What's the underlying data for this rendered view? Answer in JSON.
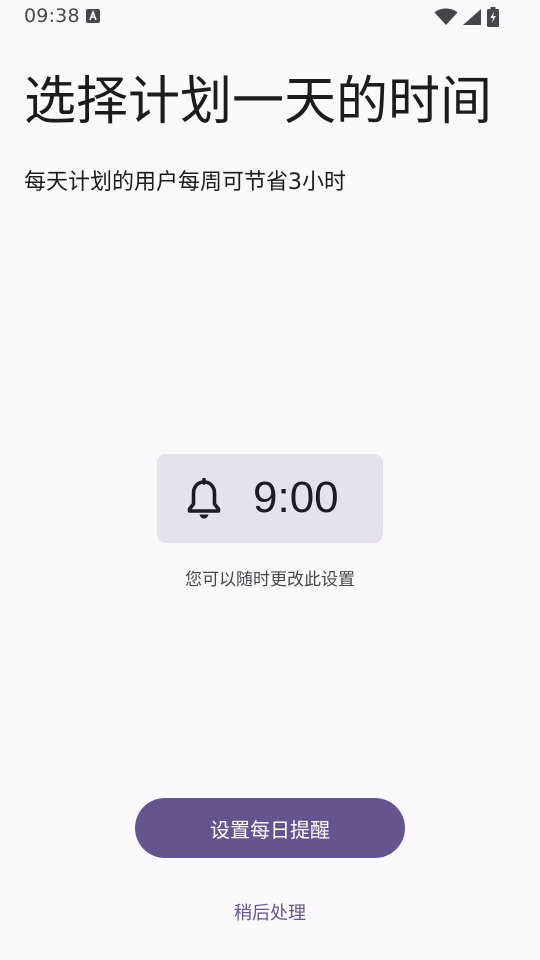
{
  "status_bar": {
    "time": "09:38",
    "icons": [
      "accessibility-a-icon",
      "wifi-icon",
      "cell-signal-icon",
      "battery-charging-icon"
    ]
  },
  "header": {
    "title": "选择计划一天的时间",
    "subtitle": "每天计划的用户每周可节省3小时"
  },
  "reminder": {
    "icon": "bell-icon",
    "time": "9:00",
    "hint": "您可以随时更改此设置"
  },
  "actions": {
    "primary_label": "设置每日提醒",
    "secondary_label": "稍后处理"
  },
  "colors": {
    "background": "#fdf8fd",
    "chip": "#e6e1ea",
    "primary": "#65558f",
    "text": "#1c1b1f",
    "secondary_text": "#49454f"
  }
}
